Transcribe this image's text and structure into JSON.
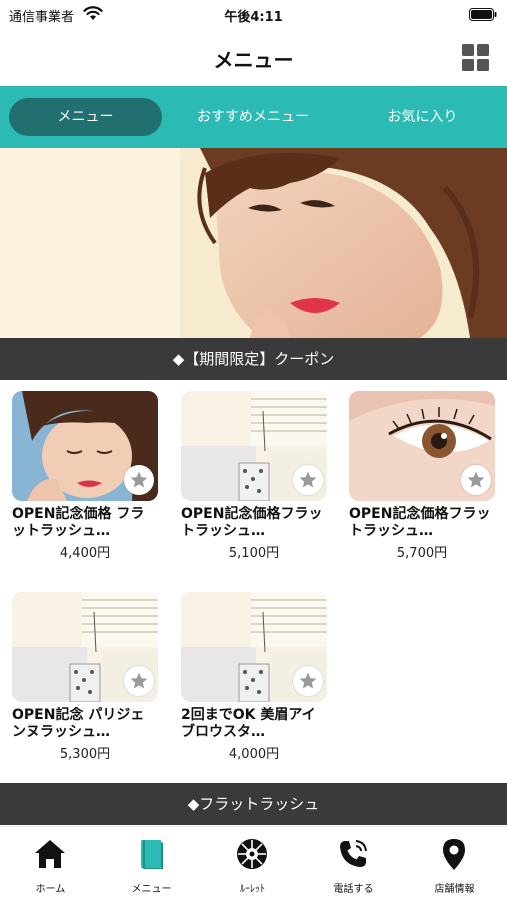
{
  "status_bar": {
    "carrier": "通信事業者",
    "time": "午後4:11"
  },
  "header": {
    "title": "メニュー"
  },
  "tabs": [
    {
      "label": "メニュー",
      "active": true
    },
    {
      "label": "おすすめメニュー",
      "active": false
    },
    {
      "label": "お気に入り",
      "active": false
    }
  ],
  "sections": {
    "coupon": "◆【期間限定】クーポン",
    "flat_lash": "◆フラットラッシュ"
  },
  "coupons": [
    {
      "title": "OPEN記念価格 フラットラッシュ…",
      "price": "4,400円"
    },
    {
      "title": "OPEN記念価格フラットラッシュ…",
      "price": "5,100円"
    },
    {
      "title": "OPEN記念価格フラットラッシュ…",
      "price": "5,700円"
    },
    {
      "title": "OPEN記念 パリジェンヌラッシュ…",
      "price": "5,300円"
    },
    {
      "title": "2回までOK 美眉アイブロウスタ…",
      "price": "4,000円"
    }
  ],
  "bottom_nav": [
    {
      "label": "ホーム",
      "icon": "home-icon"
    },
    {
      "label": "メニュー",
      "icon": "book-icon",
      "active": true
    },
    {
      "label": "ﾙｰﾚｯﾄ",
      "icon": "roulette-icon"
    },
    {
      "label": "電話する",
      "icon": "phone-icon"
    },
    {
      "label": "店舗情報",
      "icon": "map-pin-icon"
    }
  ],
  "colors": {
    "accent": "#2bbab4",
    "active_tab": "#226f70",
    "section_bg": "#3a3a3a",
    "active_nav_icon": "#2bbab4"
  }
}
